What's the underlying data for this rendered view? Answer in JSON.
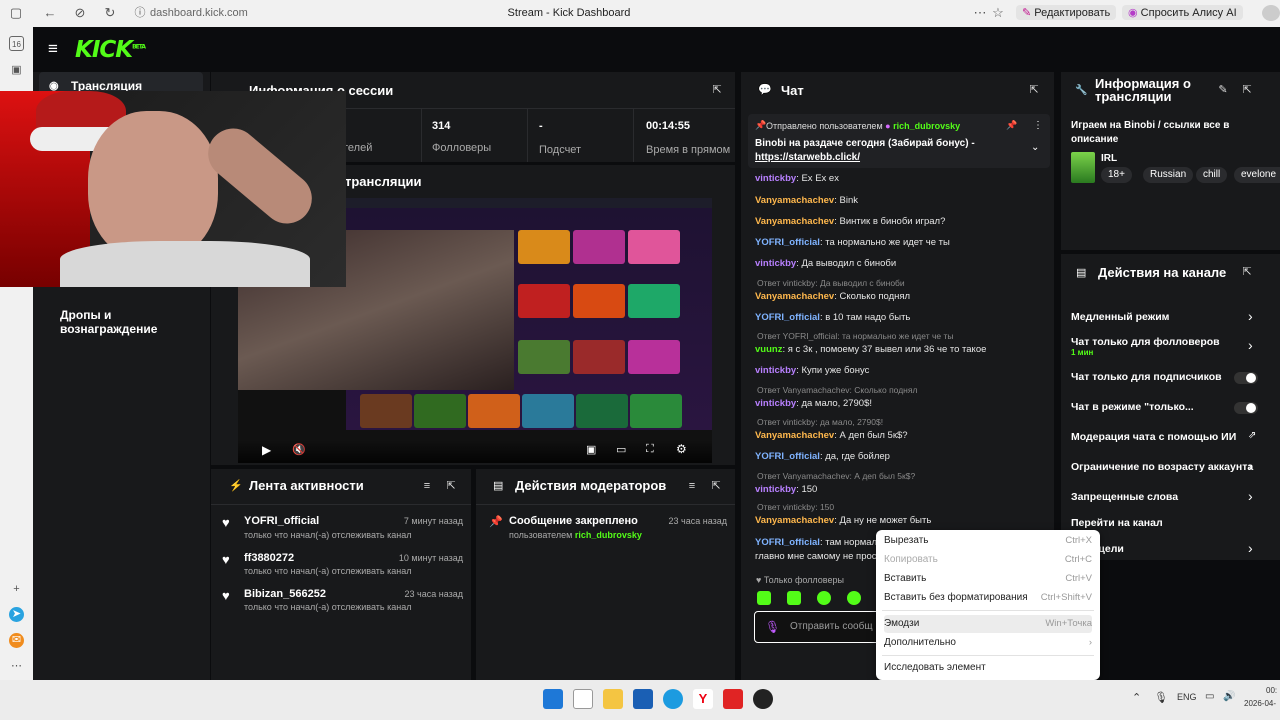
{
  "browser": {
    "url": "dashboard.kick.com",
    "title": "Stream - Kick Dashboard",
    "edit_label": "Редактировать",
    "alice_label": "Спросить Алису AI",
    "tab_count": "16"
  },
  "site": {
    "logo": "KICK",
    "logo_sup": "BETA"
  },
  "sidebar": {
    "items": [
      {
        "label": "Трансляция"
      },
      {
        "label": "Дропы и вознаграждение"
      }
    ]
  },
  "session": {
    "title": "Информация о сессии",
    "stats": [
      {
        "value": "314",
        "label": "Фолловеры"
      },
      {
        "value": "-",
        "label": "Подсчет подписок"
      },
      {
        "value": "00:14:55",
        "label": "Время в прямом эфире"
      }
    ],
    "partial_label": "телей"
  },
  "preview": {
    "title": "трансляции"
  },
  "activity": {
    "title": "Лента активности",
    "items": [
      {
        "name": "YOFRI_official",
        "sub": "только что начал(-а) отслеживать канал",
        "time": "7 минут назад"
      },
      {
        "name": "ff3880272",
        "sub": "только что начал(-а) отслеживать канал",
        "time": "10 минут назад"
      },
      {
        "name": "Bibizan_566252",
        "sub": "только что начал(-а) отслеживать канал",
        "time": "23 часа назад"
      }
    ]
  },
  "mod_actions": {
    "title": "Действия модераторов",
    "items": [
      {
        "title": "Сообщение закреплено",
        "by_prefix": "пользователем",
        "by_user": "rich_dubrovsky",
        "time": "23 часа назад"
      }
    ]
  },
  "chat": {
    "title": "Чат",
    "pinned": {
      "prefix": "Отправлено пользователем",
      "user": "rich_dubrovsky",
      "text": "Binobi на раздаче сегодня (Забирай бонус) -",
      "link": "https://starwebb.click/"
    },
    "messages": [
      {
        "user": "vintickby",
        "text": ": Ex Ex ex",
        "color": "#b880ff"
      },
      {
        "user": "Vanyamachachev",
        "text": ": Вink",
        "color": "#ffb84d"
      },
      {
        "user": "Vanyamachachev",
        "text": ": Винтик в бинoби играл?",
        "color": "#ffb84d"
      },
      {
        "user": "YOFRI_official",
        "text": ": та нормально же идет че ты",
        "color": "#7fb3ff"
      },
      {
        "user": "vintickby",
        "text": ": Да выводил с бинoби",
        "color": "#b880ff"
      },
      {
        "reply": "Ответ vintickby: Да выводил с бинoби",
        "user": "Vanyamachachev",
        "text": ": Сколько поднял",
        "color": "#ffb84d"
      },
      {
        "user": "YOFRI_official",
        "text": ": в 10 там надо быть",
        "color": "#7fb3ff"
      },
      {
        "reply": "Ответ YOFRI_official: та нормально же идет че ты",
        "user": "vuunz",
        "text": ": я с 3к , помоему 37 вывел или 36 че то такое",
        "color": "#53fc18"
      },
      {
        "user": "vintickby",
        "text": ": Купи уже бонус",
        "color": "#b880ff"
      },
      {
        "reply": "Ответ Vanyamachachev: Сколько поднял",
        "user": "vintickby",
        "text": ": да мало, 2790$!",
        "color": "#b880ff"
      },
      {
        "reply": "Ответ vintickby: да мало, 2790$!",
        "user": "Vanyamachachev",
        "text": ": А деп был 5к$?",
        "color": "#ffb84d"
      },
      {
        "user": "YOFRI_official",
        "text": ": да, где бойлер",
        "color": "#7fb3ff"
      },
      {
        "reply": "Ответ Vanyamachachev: А деп был 5к$?",
        "user": "vintickby",
        "text": ": 150",
        "color": "#b880ff"
      },
      {
        "reply": "Ответ vintickby: 150",
        "user": "Vanyamachachev",
        "text": ": Да ну не может быть",
        "color": "#ffb84d"
      },
      {
        "user": "YOFRI_official",
        "text": ": там нормал",
        "extra": "главно мне самому не прос",
        "color": "#7fb3ff"
      }
    ],
    "followers_only": "Только фолловеры",
    "input_placeholder": "Отправить сообщ"
  },
  "stream_info": {
    "title": "Информация о трансляции",
    "description": "Играем на Binobi / ссылки все в описание",
    "category": "IRL",
    "tags": [
      "18+",
      "Russian",
      "chill",
      "evelone"
    ]
  },
  "channel_actions": {
    "title": "Действия на канале",
    "items": [
      {
        "label": "Медленный режим",
        "control": "chevron"
      },
      {
        "label": "Чат только для фолловеров",
        "sub": "1 мин",
        "control": "chevron"
      },
      {
        "label": "Чат только для подписчиков",
        "control": "toggle"
      },
      {
        "label": "Чат в режиме \"только...",
        "control": "toggle"
      },
      {
        "label": "Модерация чата с помощью ИИ",
        "control": "chart"
      },
      {
        "label": "Ограничение по возрасту аккаунта",
        "control": "chevron"
      },
      {
        "label": "Запрещенные слова",
        "control": "chevron"
      },
      {
        "label": "Перейти на канал",
        "control": "none"
      },
      {
        "label": "вить цели",
        "control": "chevron"
      }
    ]
  },
  "context_menu": {
    "items": [
      {
        "label": "Вырезать",
        "shortcut": "Ctrl+X",
        "disabled": false
      },
      {
        "label": "Копировать",
        "shortcut": "Ctrl+C",
        "disabled": true
      },
      {
        "label": "Вставить",
        "shortcut": "Ctrl+V",
        "disabled": false
      },
      {
        "label": "Вставить без форматирования",
        "shortcut": "Ctrl+Shift+V",
        "disabled": false
      },
      {
        "label": "Эмодзи",
        "shortcut": "Win+Точка",
        "disabled": false
      },
      {
        "label": "Дополнительно",
        "shortcut": "›",
        "disabled": false
      },
      {
        "label": "Исследовать элемент",
        "shortcut": "",
        "disabled": false
      }
    ]
  },
  "taskbar": {
    "lang": "ENG",
    "time": "00:",
    "date": "2026-04-"
  },
  "colors": {
    "accent": "#53fc18",
    "panel": "#18191b",
    "bg": "#0b0c0e"
  }
}
